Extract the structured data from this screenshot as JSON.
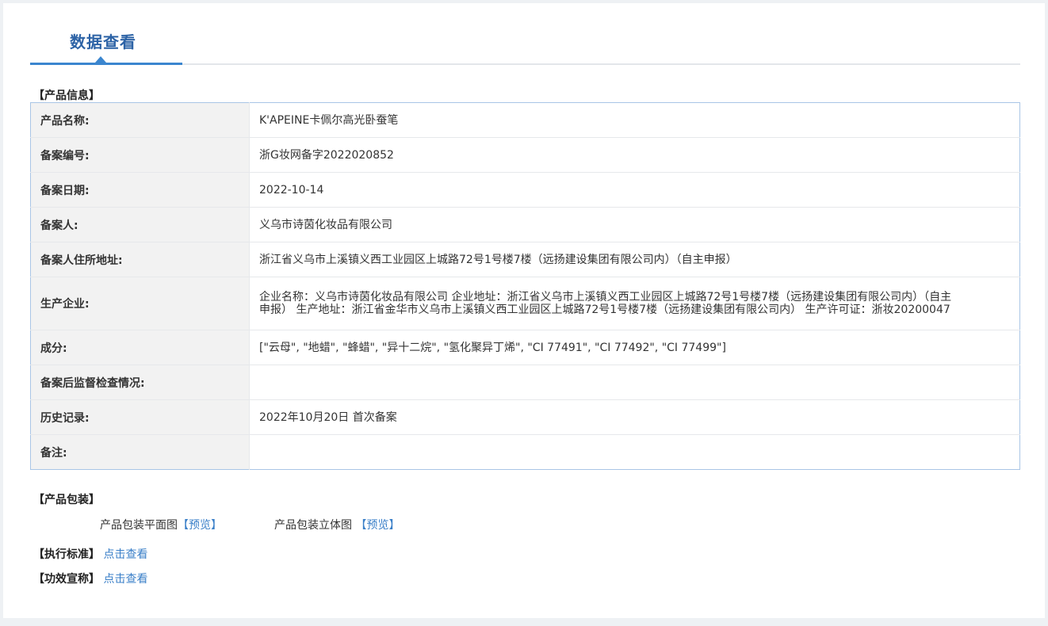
{
  "tab": {
    "title": "数据查看"
  },
  "product_info": {
    "section_title": "【产品信息】",
    "rows": [
      {
        "label": "产品名称:",
        "value": "K'APEINE卡佩尔高光卧蚕笔"
      },
      {
        "label": "备案编号:",
        "value": "浙G妆网备字2022020852"
      },
      {
        "label": "备案日期:",
        "value": "2022-10-14"
      },
      {
        "label": "备案人:",
        "value": "义乌市诗茵化妆品有限公司"
      },
      {
        "label": "备案人住所地址:",
        "value": "浙江省义乌市上溪镇义西工业园区上城路72号1号楼7楼（远扬建设集团有限公司内）（自主申报）"
      },
      {
        "label": "生产企业:",
        "value": "企业名称：义乌市诗茵化妆品有限公司 企业地址：浙江省义乌市上溪镇义西工业园区上城路72号1号楼7楼（远扬建设集团有限公司内）（自主申报） 生产地址：浙江省金华市义乌市上溪镇义西工业园区上城路72号1号楼7楼（远扬建设集团有限公司内） 生产许可证：浙妆20200047"
      },
      {
        "label": "成分:",
        "value": "[\"云母\", \"地蜡\", \"蜂蜡\", \"异十二烷\", \"氢化聚异丁烯\", \"CI 77491\", \"CI 77492\", \"CI 77499\"]"
      },
      {
        "label": "备案后监督检查情况:",
        "value": ""
      },
      {
        "label": "历史记录:",
        "value": "2022年10月20日 首次备案"
      },
      {
        "label": "备注:",
        "value": ""
      }
    ]
  },
  "packaging": {
    "section_title": "【产品包装】",
    "flat_label": "产品包装平面图",
    "flat_link": "【预览】",
    "solid_label": "产品包装立体图",
    "solid_link": "【预览】"
  },
  "standard": {
    "label": "【执行标准】",
    "link": "点击查看"
  },
  "efficacy": {
    "label": "【功效宣称】",
    "link": "点击查看"
  }
}
